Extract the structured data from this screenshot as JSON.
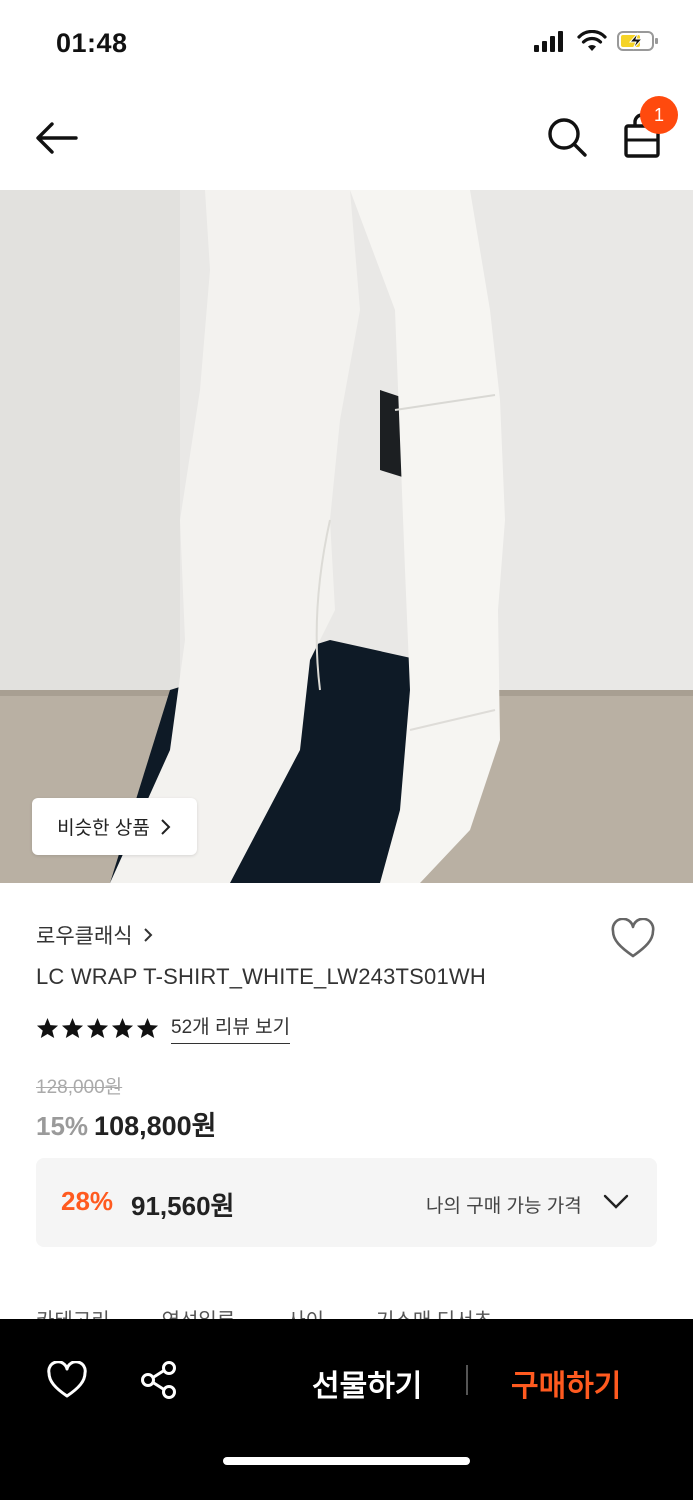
{
  "status_bar": {
    "time": "01:48"
  },
  "nav": {
    "cart_count": "1"
  },
  "hero": {
    "similar_label": "비슷한 상품"
  },
  "product": {
    "brand": "로우클래식",
    "name": "LC WRAP T-SHIRT_WHITE_LW243TS01WH",
    "rating_stars": 5,
    "review_link": "52개 리뷰 보기",
    "original_price": "128,000원",
    "discount_rate": "15%",
    "sale_price": "108,800원"
  },
  "my_price": {
    "discount_rate": "28%",
    "price": "91,560원",
    "label": "나의 구매 가능 가격"
  },
  "tabs": [
    "카테고리",
    "연선일루",
    "사이",
    "기스매 디서츠"
  ],
  "bottom_bar": {
    "gift_label": "선물하기",
    "buy_label": "구매하기"
  },
  "colors": {
    "accent": "#ff5a1f",
    "badge": "#ff4a0e",
    "bottom_bar_bg": "#000000"
  }
}
